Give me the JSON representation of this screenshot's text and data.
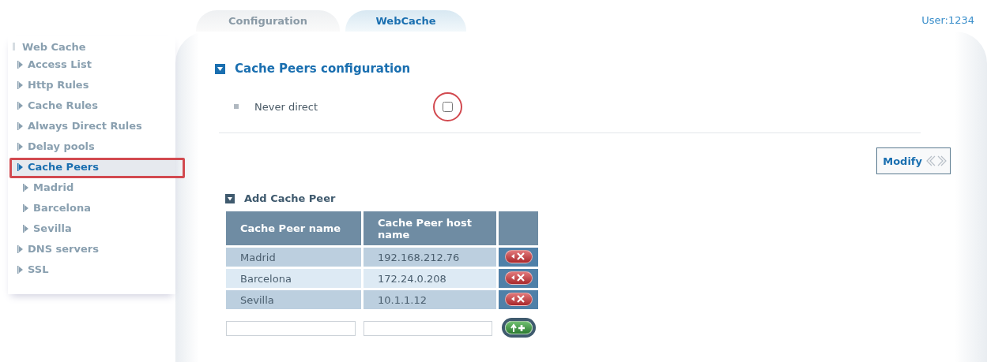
{
  "tabs": [
    {
      "label": "Configuration",
      "selected": false
    },
    {
      "label": "WebCache",
      "selected": true
    }
  ],
  "user": "User:1234",
  "sidebar": {
    "title": "Web Cache",
    "items": [
      {
        "label": "Access List",
        "selected": false,
        "highlighted": false
      },
      {
        "label": "Http Rules",
        "selected": false,
        "highlighted": false
      },
      {
        "label": "Cache Rules",
        "selected": false,
        "highlighted": false
      },
      {
        "label": "Always Direct Rules",
        "selected": false,
        "highlighted": false
      },
      {
        "label": "Delay pools",
        "selected": false,
        "highlighted": false
      },
      {
        "label": "Cache Peers",
        "selected": true,
        "highlighted": true,
        "children": [
          {
            "label": "Madrid",
            "selected": false,
            "highlighted": false
          },
          {
            "label": "Barcelona",
            "selected": false,
            "highlighted": false
          },
          {
            "label": "Sevilla",
            "selected": false,
            "highlighted": false
          }
        ]
      },
      {
        "label": "DNS servers",
        "selected": false,
        "highlighted": false
      },
      {
        "label": "SSL",
        "selected": false,
        "highlighted": false
      }
    ]
  },
  "section": {
    "title": "Cache Peers configuration",
    "expanded": true,
    "options": [
      {
        "label": "Never direct",
        "checked": false,
        "highlighted": true
      }
    ],
    "button": "Modify"
  },
  "add_section": {
    "title": "Add Cache Peer",
    "expanded": true,
    "columns": [
      "Cache Peer name",
      "Cache Peer host name"
    ],
    "rows": [
      {
        "name": "Madrid",
        "host": "192.168.212.76"
      },
      {
        "name": "Barcelona",
        "host": "172.24.0.208"
      },
      {
        "name": "Sevilla",
        "host": "10.1.1.12"
      }
    ]
  }
}
